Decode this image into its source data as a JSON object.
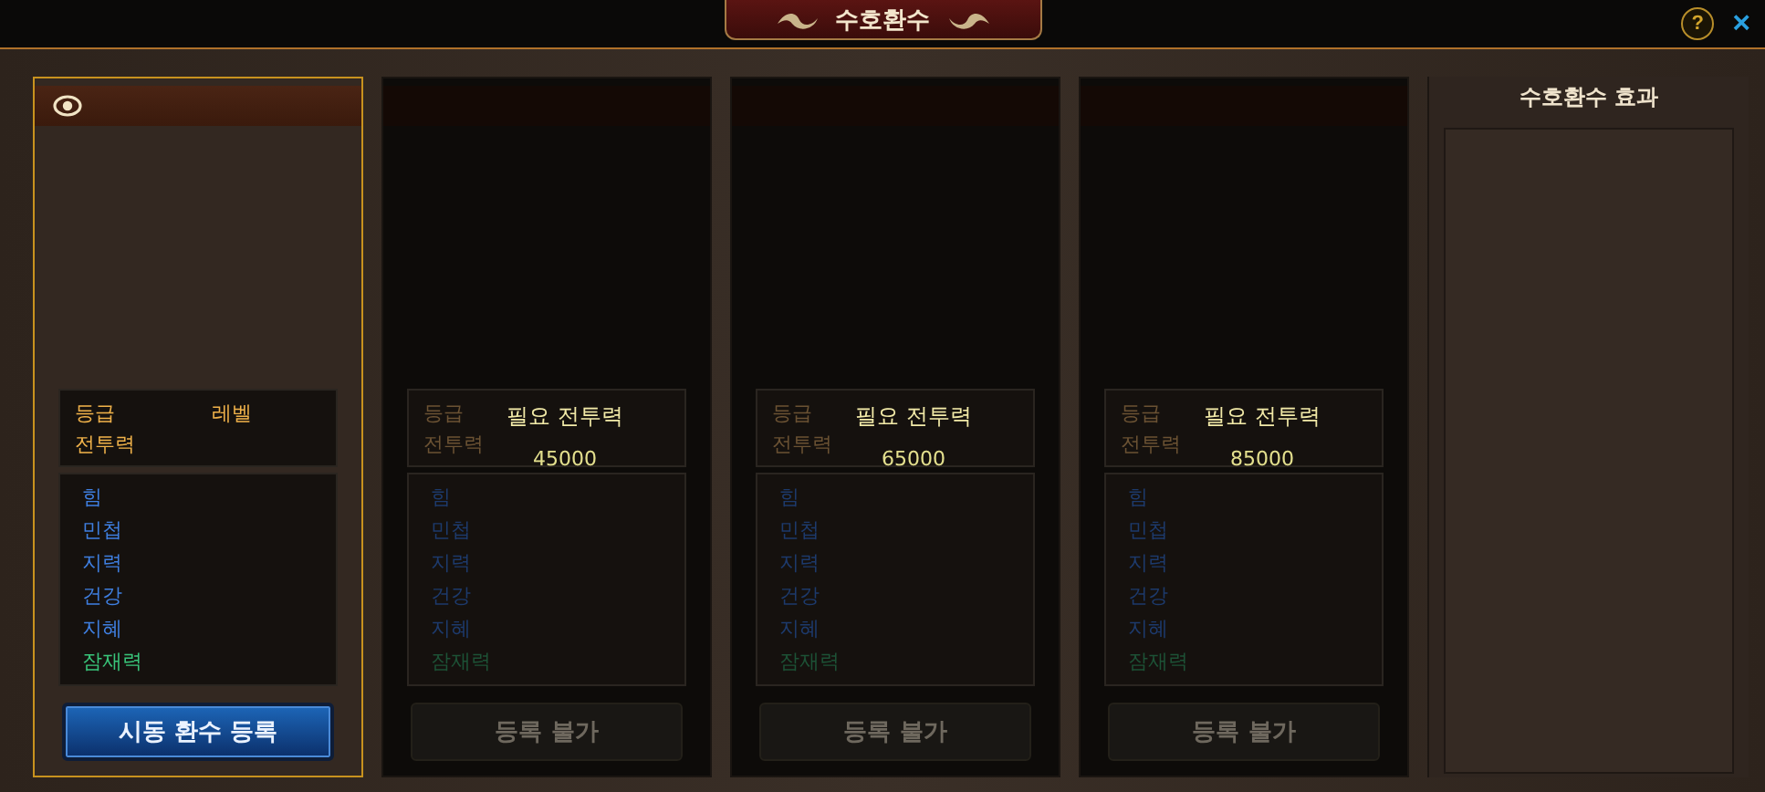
{
  "window": {
    "title": "수호환수",
    "help": "?",
    "close": "×"
  },
  "slots": [
    {
      "kind": "active",
      "selected": true,
      "grade_label": "등급",
      "level_label": "레벨",
      "power_label": "전투력",
      "stats": [
        {
          "label": "힘",
          "kind": "stat"
        },
        {
          "label": "민첩",
          "kind": "stat"
        },
        {
          "label": "지력",
          "kind": "stat"
        },
        {
          "label": "건강",
          "kind": "stat"
        },
        {
          "label": "지혜",
          "kind": "stat"
        },
        {
          "label": "잠재력",
          "kind": "potential"
        }
      ],
      "button": {
        "label": "시동 환수 등록",
        "disabled": false
      }
    },
    {
      "kind": "locked",
      "selected": false,
      "grade_label": "등급",
      "power_label": "전투력",
      "required_label": "필요 전투력",
      "required_value": "45000",
      "stats": [
        {
          "label": "힘",
          "kind": "stat"
        },
        {
          "label": "민첩",
          "kind": "stat"
        },
        {
          "label": "지력",
          "kind": "stat"
        },
        {
          "label": "건강",
          "kind": "stat"
        },
        {
          "label": "지혜",
          "kind": "stat"
        },
        {
          "label": "잠재력",
          "kind": "potential"
        }
      ],
      "button": {
        "label": "등록 불가",
        "disabled": true
      }
    },
    {
      "kind": "locked",
      "selected": false,
      "grade_label": "등급",
      "power_label": "전투력",
      "required_label": "필요 전투력",
      "required_value": "65000",
      "stats": [
        {
          "label": "힘",
          "kind": "stat"
        },
        {
          "label": "민첩",
          "kind": "stat"
        },
        {
          "label": "지력",
          "kind": "stat"
        },
        {
          "label": "건강",
          "kind": "stat"
        },
        {
          "label": "지혜",
          "kind": "stat"
        },
        {
          "label": "잠재력",
          "kind": "potential"
        }
      ],
      "button": {
        "label": "등록 불가",
        "disabled": true
      }
    },
    {
      "kind": "locked",
      "selected": false,
      "grade_label": "등급",
      "power_label": "전투력",
      "required_label": "필요 전투력",
      "required_value": "85000",
      "stats": [
        {
          "label": "힘",
          "kind": "stat"
        },
        {
          "label": "민첩",
          "kind": "stat"
        },
        {
          "label": "지력",
          "kind": "stat"
        },
        {
          "label": "건강",
          "kind": "stat"
        },
        {
          "label": "지혜",
          "kind": "stat"
        },
        {
          "label": "잠재력",
          "kind": "potential"
        }
      ],
      "button": {
        "label": "등록 불가",
        "disabled": true
      }
    }
  ],
  "effects_panel": {
    "title": "수호환수 효과"
  }
}
